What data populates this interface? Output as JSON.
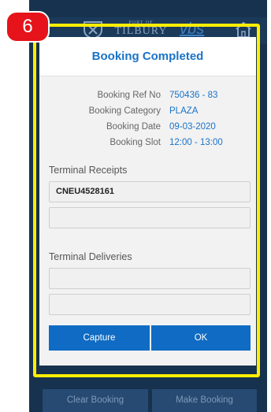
{
  "step_badge": "6",
  "header": {
    "logo_small": "PORT OF",
    "logo_big": "TILBURY",
    "vbs_logo": "vbs",
    "logo_icon": "port-emblem-icon",
    "home_icon": "home-icon"
  },
  "dialog": {
    "title": "Booking Completed",
    "details": [
      {
        "label": "Booking Ref No",
        "value": "750436 - 83"
      },
      {
        "label": "Booking Category",
        "value": "PLAZA"
      },
      {
        "label": "Booking Date",
        "value": "09-03-2020"
      },
      {
        "label": "Booking Slot",
        "value": "12:00 - 13:00"
      }
    ],
    "terminal_receipts": {
      "title": "Terminal Receipts",
      "fields": [
        "CNEU4528161",
        ""
      ]
    },
    "terminal_deliveries": {
      "title": "Terminal Deliveries",
      "fields": [
        "",
        ""
      ]
    },
    "capture_button": "Capture",
    "ok_button": "OK"
  },
  "footer": {
    "clear_button": "Clear Booking",
    "make_button": "Make Booking"
  },
  "colors": {
    "accent": "#1a73c7",
    "button": "#0f6bc3",
    "highlight": "#ffee00",
    "badge": "#e6131a",
    "app_background": "#16324e"
  }
}
